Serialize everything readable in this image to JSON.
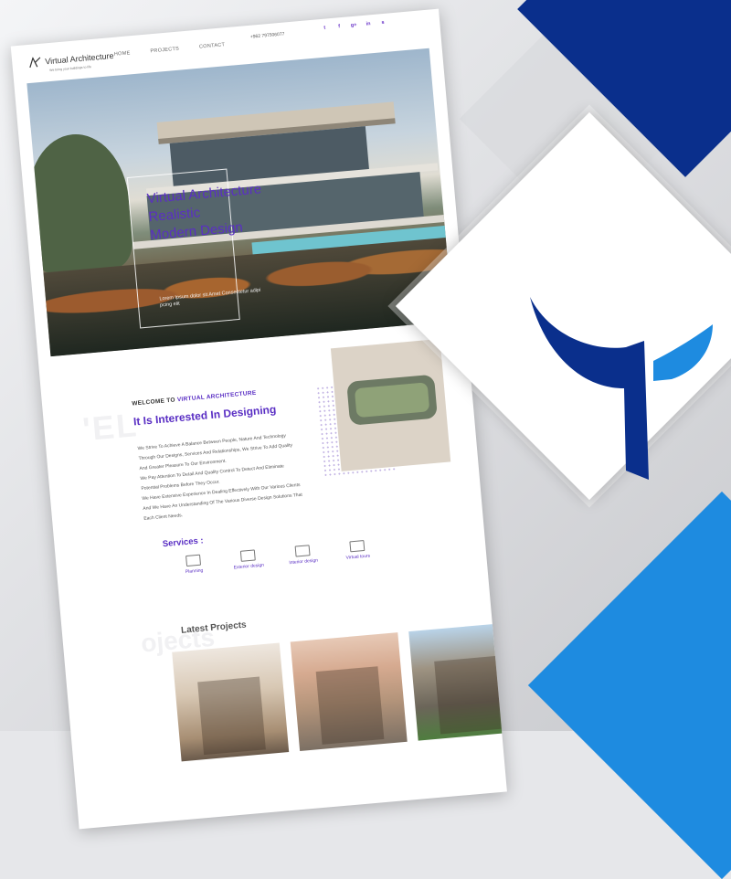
{
  "colors": {
    "accent_purple": "#5a2fc4",
    "navy": "#0a2f8c",
    "brand_blue": "#1e8be0",
    "white": "#ffffff"
  },
  "site": {
    "logo_icon": "va-monogram-icon",
    "name": "Virtual Architecture",
    "tagline": "We bring your buildings to life",
    "nav": [
      "HOME",
      "PROJECTS",
      "CONTACT"
    ],
    "phone": "+962 797506077",
    "social_icons": [
      {
        "icon": "twitter-icon",
        "glyph": "t"
      },
      {
        "icon": "facebook-icon",
        "glyph": "f"
      },
      {
        "icon": "google-plus-icon",
        "glyph": "g+"
      },
      {
        "icon": "linkedin-icon",
        "glyph": "in"
      },
      {
        "icon": "skype-icon",
        "glyph": "s"
      }
    ]
  },
  "hero": {
    "title_lines": [
      "Virtual Architecture",
      "Realistic",
      "Modern Design"
    ],
    "subtitle": "Lorem Ipsum dolor sit Amet Consectetur adipi pcing elit"
  },
  "welcome": {
    "prefix": "WELCOME TO",
    "highlight": "VIRTUAL ARCHITECTURE",
    "heading": "It Is Interested In Designing",
    "body_lines": [
      "We Strive To Achieve A Balance Between People, Nature And Technology",
      "Through Our Designs, Services And Relationships, We Strive To Add Quality",
      "And Greater Pleasure To Our Environment.",
      "We Pay Attention To Detail And Quality Control To Detect And Eliminate",
      "Potential Problems Before They Occur.",
      "We Have Extensive Experience In Dealing Effectively With Our Various Clients",
      "And We Have An Understanding Of The Various Diverse Design Solutions That",
      "Each Client Needs."
    ],
    "ghost_text": "'EL"
  },
  "services": {
    "label": "Services :",
    "items": [
      {
        "label": "Planning",
        "icon": "planning-icon"
      },
      {
        "label": "Exterior design",
        "icon": "exterior-design-icon"
      },
      {
        "label": "Interior design",
        "icon": "interior-design-icon"
      },
      {
        "label": "Virtual tours",
        "icon": "virtual-tours-icon"
      }
    ]
  },
  "projects": {
    "title": "Latest Projects",
    "ghost_text": "ojects"
  },
  "brand_logo": "winged-t-logo-icon"
}
